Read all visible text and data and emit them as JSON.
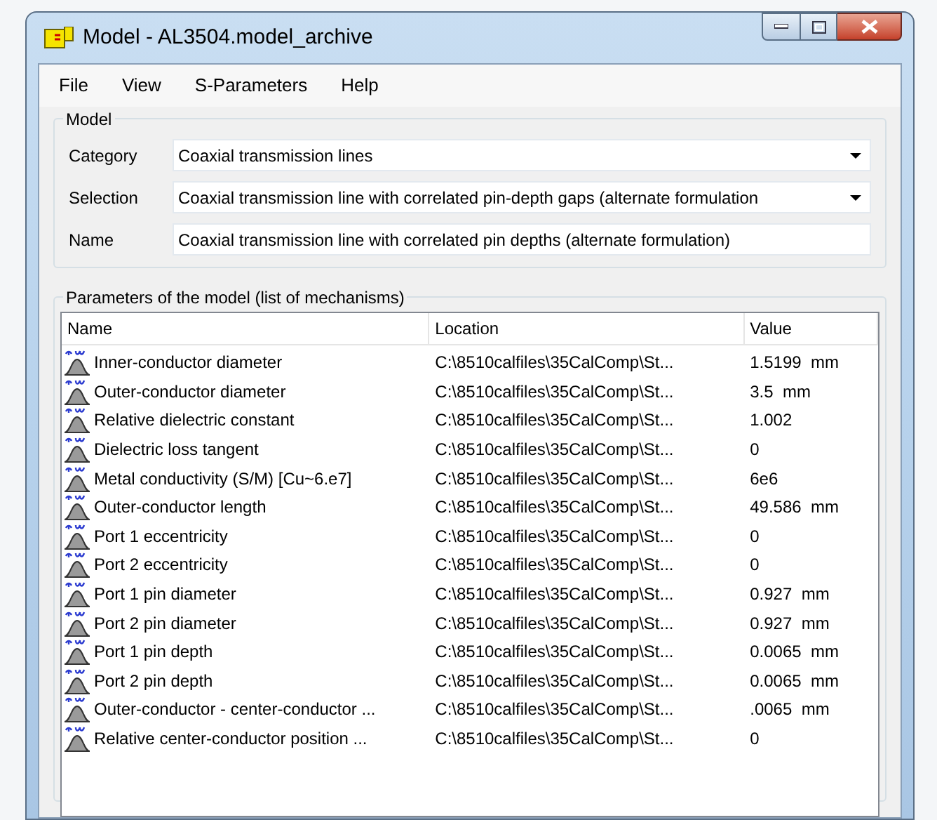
{
  "window": {
    "title": "Model - AL3504.model_archive"
  },
  "menu": [
    "File",
    "View",
    "S-Parameters",
    "Help"
  ],
  "model_group": {
    "title": "Model",
    "fields": [
      {
        "label": "Category",
        "value": "Coaxial transmission lines",
        "kind": "dropdown"
      },
      {
        "label": "Selection",
        "value": "Coaxial transmission line with correlated pin-depth gaps (alternate formulation",
        "kind": "dropdown"
      },
      {
        "label": "Name",
        "value": "Coaxial transmission line with correlated pin depths (alternate formulation)",
        "kind": "text"
      }
    ]
  },
  "parameters_group": {
    "title": "Parameters of the model (list of mechanisms)",
    "table": {
      "columns": [
        "Name",
        "Location",
        "Value"
      ],
      "rows": [
        {
          "name": "Inner-conductor diameter",
          "location": "C:\\8510calfiles\\35CalComp\\St...",
          "value": "1.5199  mm"
        },
        {
          "name": "Outer-conductor diameter",
          "location": "C:\\8510calfiles\\35CalComp\\St...",
          "value": "3.5  mm"
        },
        {
          "name": "Relative dielectric constant",
          "location": "C:\\8510calfiles\\35CalComp\\St...",
          "value": "1.002"
        },
        {
          "name": "Dielectric loss tangent",
          "location": "C:\\8510calfiles\\35CalComp\\St...",
          "value": "0"
        },
        {
          "name": "Metal conductivity (S/M) [Cu~6.e7]",
          "location": "C:\\8510calfiles\\35CalComp\\St...",
          "value": "6e6"
        },
        {
          "name": "Outer-conductor length",
          "location": "C:\\8510calfiles\\35CalComp\\St...",
          "value": "49.586  mm"
        },
        {
          "name": "Port 1 eccentricity",
          "location": "C:\\8510calfiles\\35CalComp\\St...",
          "value": "0"
        },
        {
          "name": "Port 2 eccentricity",
          "location": "C:\\8510calfiles\\35CalComp\\St...",
          "value": "0"
        },
        {
          "name": "Port 1 pin diameter",
          "location": "C:\\8510calfiles\\35CalComp\\St...",
          "value": "0.927  mm"
        },
        {
          "name": "Port 2 pin diameter",
          "location": "C:\\8510calfiles\\35CalComp\\St...",
          "value": "0.927  mm"
        },
        {
          "name": "Port 1 pin depth",
          "location": "C:\\8510calfiles\\35CalComp\\St...",
          "value": "0.0065  mm"
        },
        {
          "name": "Port 2 pin depth",
          "location": "C:\\8510calfiles\\35CalComp\\St...",
          "value": "0.0065  mm"
        },
        {
          "name": "Outer-conductor - center-conductor ...",
          "location": "C:\\8510calfiles\\35CalComp\\St...",
          "value": ".0065  mm"
        },
        {
          "name": "Relative center-conductor position ...",
          "location": "C:\\8510calfiles\\35CalComp\\St...",
          "value": "0"
        }
      ]
    }
  }
}
